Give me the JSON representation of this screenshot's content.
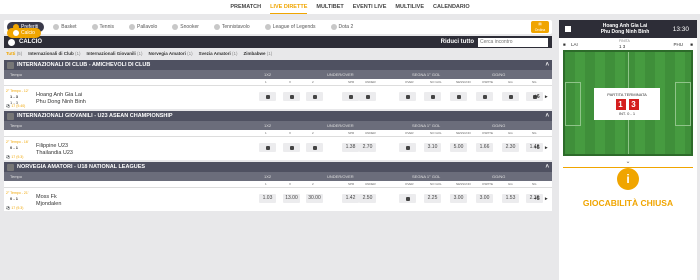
{
  "topnav": [
    "PREMATCH",
    "LIVE DIRETTE",
    "MULTIBET",
    "EVENTI LIVE",
    "MULTILIVE",
    "CALENDARIO"
  ],
  "sports": [
    {
      "label": "Preferiti",
      "style": "pref",
      "icon": "star-icon"
    },
    {
      "label": "Calcio",
      "style": "sel",
      "icon": "soccer-ball-icon"
    },
    {
      "label": "Basket",
      "style": "",
      "icon": "basketball-icon"
    },
    {
      "label": "Tennis",
      "style": "",
      "icon": "tennis-icon"
    },
    {
      "label": "Pallavolo",
      "style": "",
      "icon": "volleyball-icon"
    },
    {
      "label": "Snooker",
      "style": "",
      "icon": "snooker-icon"
    },
    {
      "label": "Tennistavolo",
      "style": "",
      "icon": "table-tennis-icon"
    },
    {
      "label": "League of Legends",
      "style": "",
      "icon": "lol-icon"
    },
    {
      "label": "Dota 2",
      "style": "",
      "icon": "dota-icon"
    }
  ],
  "filter_btn": "Ordina",
  "calcio": {
    "title": "CALCIO",
    "collapse": "Riduci tutto",
    "search_placeholder": "Cerca incontro"
  },
  "filters": [
    {
      "label": "Tutti",
      "count": "(5)"
    },
    {
      "label": "Internazionali di Club",
      "count": "(1)"
    },
    {
      "label": "Internazionali Giovanili",
      "count": "(1)"
    },
    {
      "label": "Norvegia Amatori",
      "count": "(1)"
    },
    {
      "label": "Svezia Amatori",
      "count": "(1)"
    },
    {
      "label": "Zimbabwe",
      "count": "(1)"
    }
  ],
  "colheads": {
    "tempo": "Tempo",
    "m1x2": "1X2",
    "uo": "UNDER/OVER",
    "segna": "SEGNA 1° GOL",
    "gg": "GG/NG"
  },
  "subheads": [
    "1",
    "X",
    "2",
    "SPR",
    "UNDER",
    "OVER",
    "NO GOL",
    "NESSUNO",
    "OSPITE",
    "GG",
    "NG"
  ],
  "groups": [
    {
      "title": "INTERNAZIONALI DI CLUB - AMICHEVOLI DI CLUB",
      "match": {
        "live": "2° Tempo - 12'",
        "score": "1 - 3",
        "score2": "1 - 3",
        "min": "⚽ 17 (9.40)",
        "team1": "Hoang Anh Gia Lai",
        "team2": "Phu Dong Ninh Binh",
        "odds": [
          "",
          "",
          "",
          "",
          "",
          "",
          "",
          "",
          "",
          "",
          ""
        ],
        "locked": true,
        "spr": "",
        "plus": "+6"
      }
    },
    {
      "title": "INTERNAZIONALI GIOVANILI - U23 ASEAN CHAMPIONSHIP",
      "match": {
        "live": "2° Tempo - 16'",
        "score": "0 - 1",
        "score2": "",
        "min": "⚽ 17 (9.3)",
        "team1": "Filippine U23",
        "team2": "Thailandia U23",
        "odds": [
          "",
          "",
          "",
          "1.38",
          "2.70",
          "",
          "3.10",
          "5.00",
          "1.66",
          "2.30",
          "1.48"
        ],
        "locked": false,
        "spr": "1.5",
        "plus": "+5"
      }
    },
    {
      "title": "NORVEGIA AMATORI - U18 NATIONAL LEAGUES",
      "match": {
        "live": "2° Tempo - 21'",
        "score": "0 - 1",
        "score2": "",
        "min": "⚽ 17 (9.3)",
        "team1": "Moss Fk",
        "team2": "Mjondalen",
        "odds": [
          "1.03",
          "13.00",
          "30.00",
          "1.42",
          "2.50",
          "",
          "2.25",
          "3.00",
          "3.00",
          "1.53",
          "2.30"
        ],
        "locked": false,
        "spr": "1.5",
        "plus": "+5"
      }
    }
  ],
  "sidebar": {
    "team1": "Hoang Anh Gia Lai",
    "team2": "Phu Dong Ninh Binh",
    "time": "13:30",
    "t1short": "LAI",
    "t2short": "PHU",
    "half_label": "FINITA",
    "half_score": "1   3",
    "final_label": "PARTITA TERMINATA",
    "final_s1": "1",
    "final_s2": "3",
    "final_sub": "INT. 0 - 1",
    "closed_label": "GIOCABILITÀ CHIUSA"
  }
}
